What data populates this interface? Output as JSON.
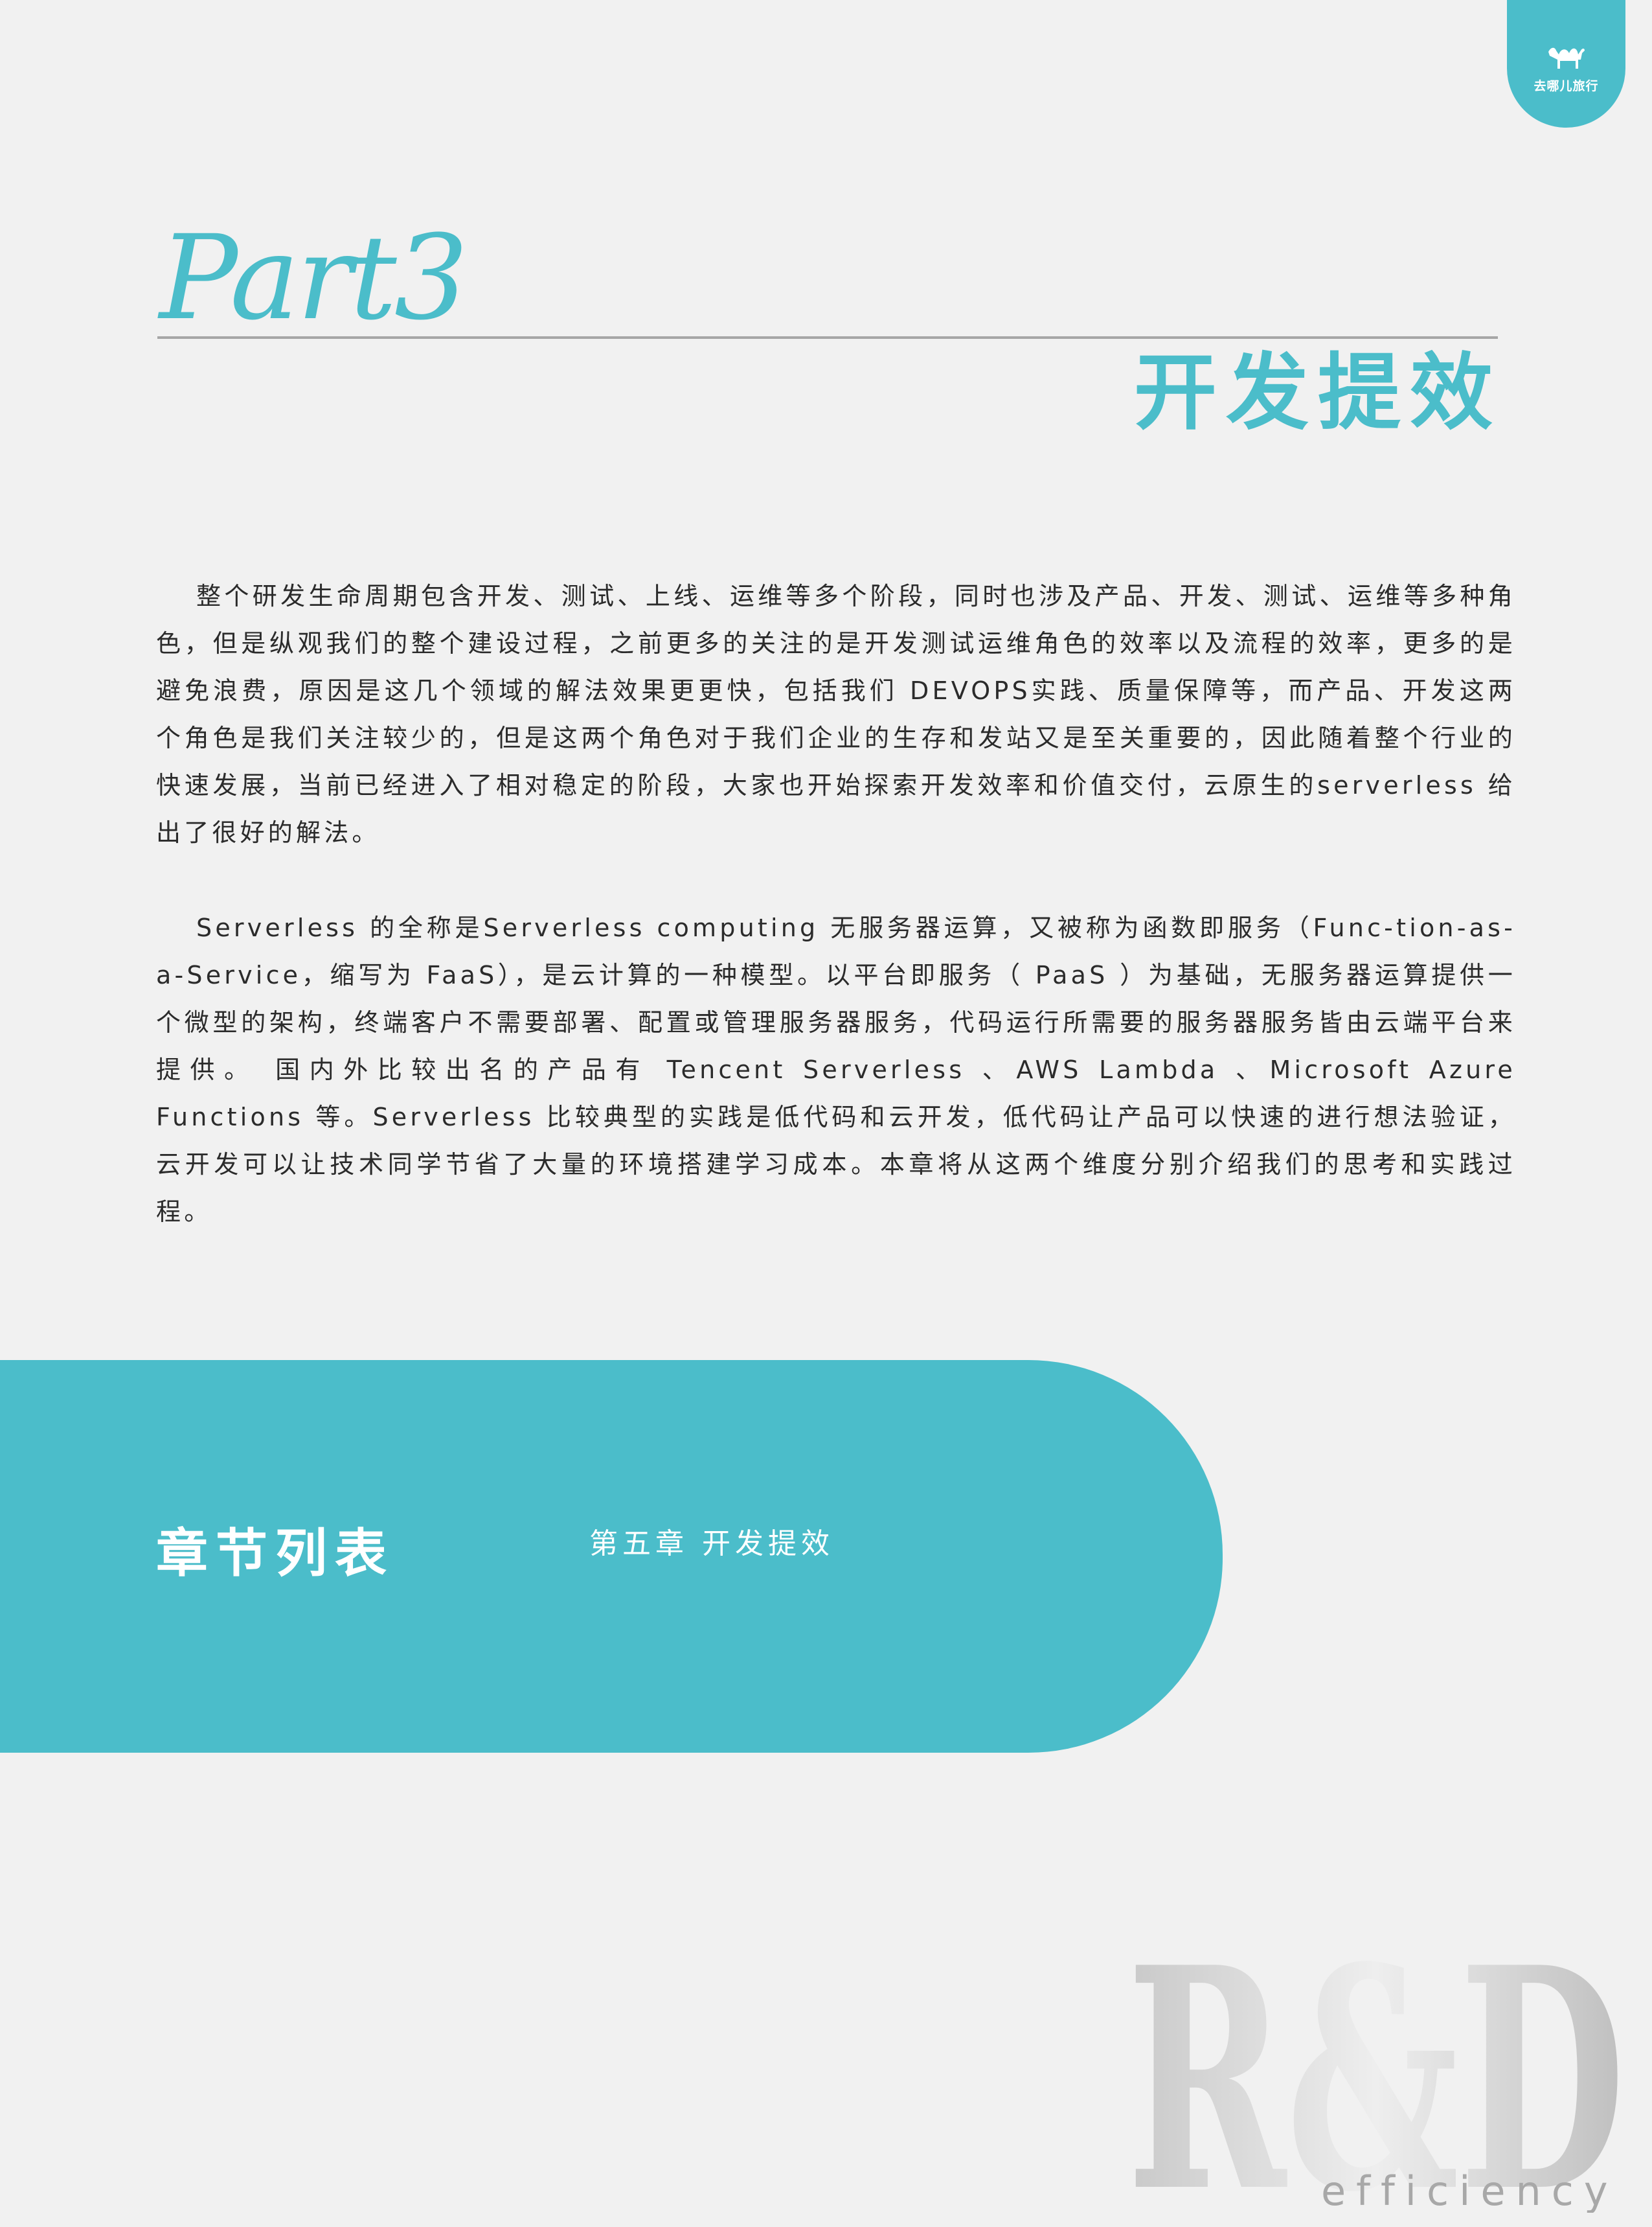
{
  "brand": {
    "name": "去哪儿旅行",
    "tab_color": "#4bbdca"
  },
  "header": {
    "part_label": "Part3",
    "section_title": "开发提效"
  },
  "body": {
    "paragraph_1": "整个研发生命周期包含开发、测试、上线、运维等多个阶段，同时也涉及产品、开发、测试、运维等多种角色，但是纵观我们的整个建设过程，之前更多的关注的是开发测试运维角色的效率以及流程的效率，更多的是避免浪费，原因是这几个领域的解法效果更更快，包括我们 DEVOPS实践、质量保障等，而产品、开发这两个角色是我们关注较少的，但是这两个角色对于我们企业的生存和发站又是至关重要的，因此随着整个行业的快速发展，当前已经进入了相对稳定的阶段，大家也开始探索开发效率和价值交付，云原生的serverless 给出了很好的解法。",
    "paragraph_2": "Serverless 的全称是Serverless computing 无服务器运算，又被称为函数即服务（Func-tion-as-a-Service，缩写为 FaaS），是云计算的一种模型。以平台即服务（ PaaS ）为基础，无服务器运算提供一个微型的架构，终端客户不需要部署、配置或管理服务器服务，代码运行所需要的服务器服务皆由云端平台来提供。 国内外比较出名的产品有 Tencent Serverless 、AWS Lambda 、Microsoft Azure Functions 等。Serverless 比较典型的实践是低代码和云开发，低代码让产品可以快速的进行想法验证，云开发可以让技术同学节省了大量的环境搭建学习成本。本章将从这两个维度分别介绍我们的思考和实践过程。"
  },
  "chapter_list": {
    "heading": "章节列表",
    "items": [
      "第五章 开发提效"
    ],
    "band_color": "#4bbdca"
  },
  "watermark": {
    "text": "R&D",
    "subtext": "efficiency"
  }
}
